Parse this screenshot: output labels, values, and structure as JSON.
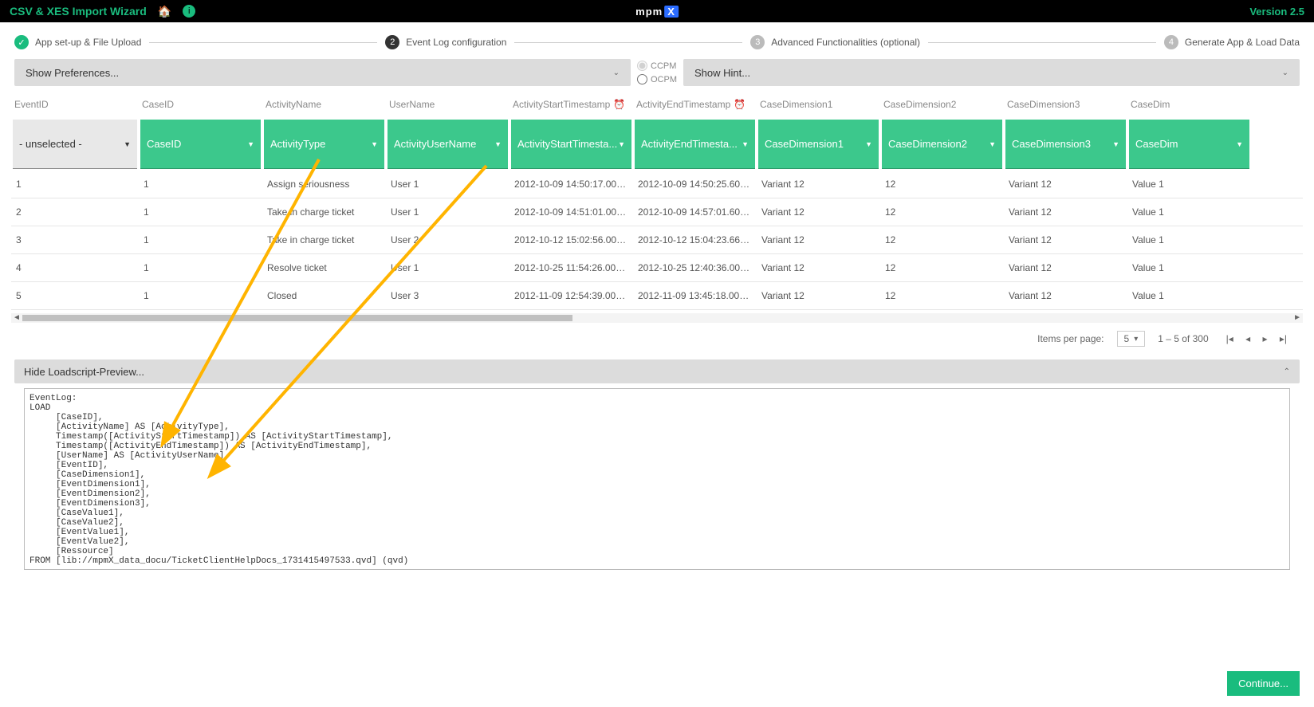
{
  "topbar": {
    "title": "CSV & XES Import Wizard",
    "version": "Version 2.5",
    "logo_a": "mpm",
    "logo_b": "X"
  },
  "stepper": {
    "s1": "App set-up & File Upload",
    "s2": "Event Log configuration",
    "s3": "Advanced Functionalities (optional)",
    "s4": "Generate App & Load Data"
  },
  "prefs": {
    "show_pref": "Show Preferences...",
    "ccpm": "CCPM",
    "ocpm": "OCPM",
    "show_hint": "Show Hint..."
  },
  "cols": {
    "c0": "EventID",
    "c1": "CaseID",
    "c2": "ActivityName",
    "c3": "UserName",
    "c4": "ActivityStartTimestamp",
    "c5": "ActivityEndTimestamp",
    "c6": "CaseDimension1",
    "c7": "CaseDimension2",
    "c8": "CaseDimension3",
    "c9": "CaseDim"
  },
  "sel": {
    "s0": "- unselected -",
    "s1": "CaseID",
    "s2": "ActivityType",
    "s3": "ActivityUserName",
    "s4": "ActivityStartTimesta...",
    "s5": "ActivityEndTimesta...",
    "s6": "CaseDimension1",
    "s7": "CaseDimension2",
    "s8": "CaseDimension3",
    "s9": "CaseDim"
  },
  "rows": [
    {
      "id": "1",
      "case": "1",
      "act": "Assign seriousness",
      "user": "User 1",
      "start": "2012-10-09 14:50:17.000000000",
      "end": "2012-10-09 14:50:25.600000000",
      "d1": "Variant 12",
      "d2": "12",
      "d3": "Variant 12",
      "d4": "Value 1"
    },
    {
      "id": "2",
      "case": "1",
      "act": "Take in charge ticket",
      "user": "User 1",
      "start": "2012-10-09 14:51:01.000000000",
      "end": "2012-10-09 14:57:01.600000000",
      "d1": "Variant 12",
      "d2": "12",
      "d3": "Variant 12",
      "d4": "Value 1"
    },
    {
      "id": "3",
      "case": "1",
      "act": "Take in charge ticket",
      "user": "User 2",
      "start": "2012-10-12 15:02:56.000000000",
      "end": "2012-10-12 15:04:23.666666666",
      "d1": "Variant 12",
      "d2": "12",
      "d3": "Variant 12",
      "d4": "Value 1"
    },
    {
      "id": "4",
      "case": "1",
      "act": "Resolve ticket",
      "user": "User 1",
      "start": "2012-10-25 11:54:26.000000000",
      "end": "2012-10-25 12:40:36.000000000",
      "d1": "Variant 12",
      "d2": "12",
      "d3": "Variant 12",
      "d4": "Value 1"
    },
    {
      "id": "5",
      "case": "1",
      "act": "Closed",
      "user": "User 3",
      "start": "2012-11-09 12:54:39.000000000",
      "end": "2012-11-09 13:45:18.000000000",
      "d1": "Variant 12",
      "d2": "12",
      "d3": "Variant 12",
      "d4": "Value 1"
    }
  ],
  "pager": {
    "items_per_page": "Items per page:",
    "pp_val": "5",
    "range": "1 – 5 of 300"
  },
  "loadscript": {
    "toggle": "Hide Loadscript-Preview..."
  },
  "script": "EventLog:\nLOAD\n     [CaseID],\n     [ActivityName] AS [ActivityType],\n     Timestamp([ActivityStartTimestamp]) AS [ActivityStartTimestamp],\n     Timestamp([ActivityEndTimestamp]) AS [ActivityEndTimestamp],\n     [UserName] AS [ActivityUserName],\n     [EventID],\n     [CaseDimension1],\n     [EventDimension1],\n     [EventDimension2],\n     [EventDimension3],\n     [CaseValue1],\n     [CaseValue2],\n     [EventValue1],\n     [EventValue2],\n     [Ressource]\nFROM [lib://mpmX_data_docu/TicketClientHelpDocs_1731415497533.qvd] (qvd)",
  "continue": "Continue..."
}
